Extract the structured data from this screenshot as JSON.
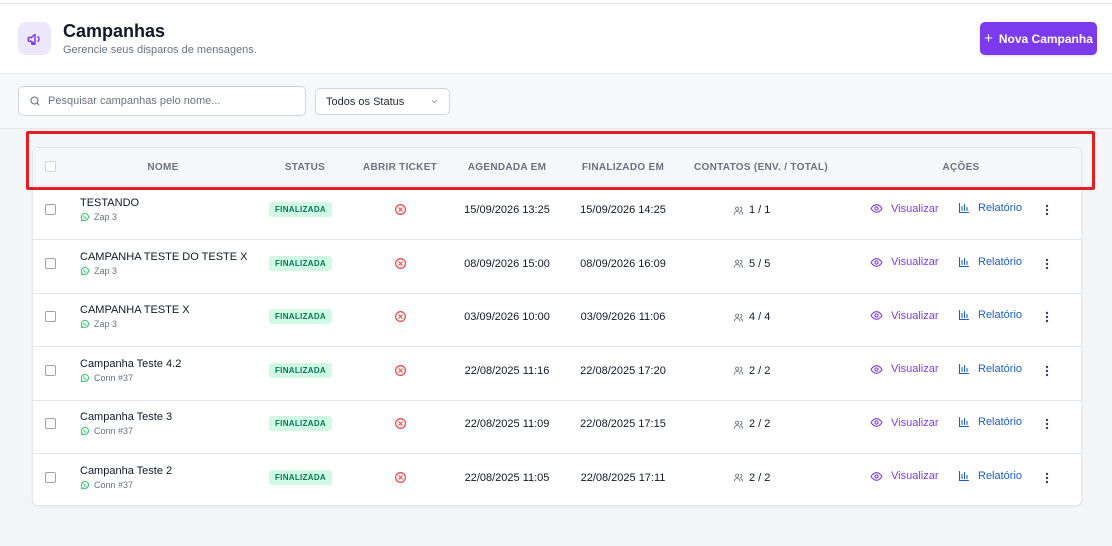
{
  "header": {
    "title": "Campanhas",
    "subtitle": "Gerencie seus disparos de mensagens.",
    "new_button": "Nova Campanha",
    "icon": "megaphone-icon",
    "accent": "#7c3aed"
  },
  "filters": {
    "search_placeholder": "Pesquisar campanhas pelo nome...",
    "status_select": "Todos os Status"
  },
  "table": {
    "columns": [
      "NOME",
      "STATUS",
      "ABRIR TICKET",
      "AGENDADA EM",
      "FINALIZADO EM",
      "CONTATOS (ENV. / TOTAL)",
      "AÇÕES"
    ],
    "view_label": "Visualizar",
    "report_label": "Relatório",
    "rows": [
      {
        "name": "TESTANDO",
        "connection": "Zap 3",
        "status": "FINALIZADA",
        "scheduled": "15/09/2026 13:25",
        "finished": "15/09/2026 14:25",
        "contacts": "1 / 1"
      },
      {
        "name": "CAMPANHA TESTE DO TESTE X",
        "connection": "Zap 3",
        "status": "FINALIZADA",
        "scheduled": "08/09/2026 15:00",
        "finished": "08/09/2026 16:09",
        "contacts": "5 / 5"
      },
      {
        "name": "CAMPANHA TESTE X",
        "connection": "Zap 3",
        "status": "FINALIZADA",
        "scheduled": "03/09/2026 10:00",
        "finished": "03/09/2026 11:06",
        "contacts": "4 / 4"
      },
      {
        "name": "Campanha Teste 4.2",
        "connection": "Conn #37",
        "status": "FINALIZADA",
        "scheduled": "22/08/2025 11:16",
        "finished": "22/08/2025 17:20",
        "contacts": "2 / 2"
      },
      {
        "name": "Campanha Teste 3",
        "connection": "Conn #37",
        "status": "FINALIZADA",
        "scheduled": "22/08/2025 11:09",
        "finished": "22/08/2025 17:15",
        "contacts": "2 / 2"
      },
      {
        "name": "Campanha Teste 2",
        "connection": "Conn #37",
        "status": "FINALIZADA",
        "scheduled": "22/08/2025 11:05",
        "finished": "22/08/2025 17:11",
        "contacts": "2 / 2"
      }
    ]
  },
  "colors": {
    "status_badge_bg": "#d1fae5",
    "status_badge_text": "#047857",
    "ticket_icon": "#ef4444",
    "view_link": "#7c3aed",
    "report_link": "#1d5fc4",
    "highlight": "#e31e24"
  }
}
